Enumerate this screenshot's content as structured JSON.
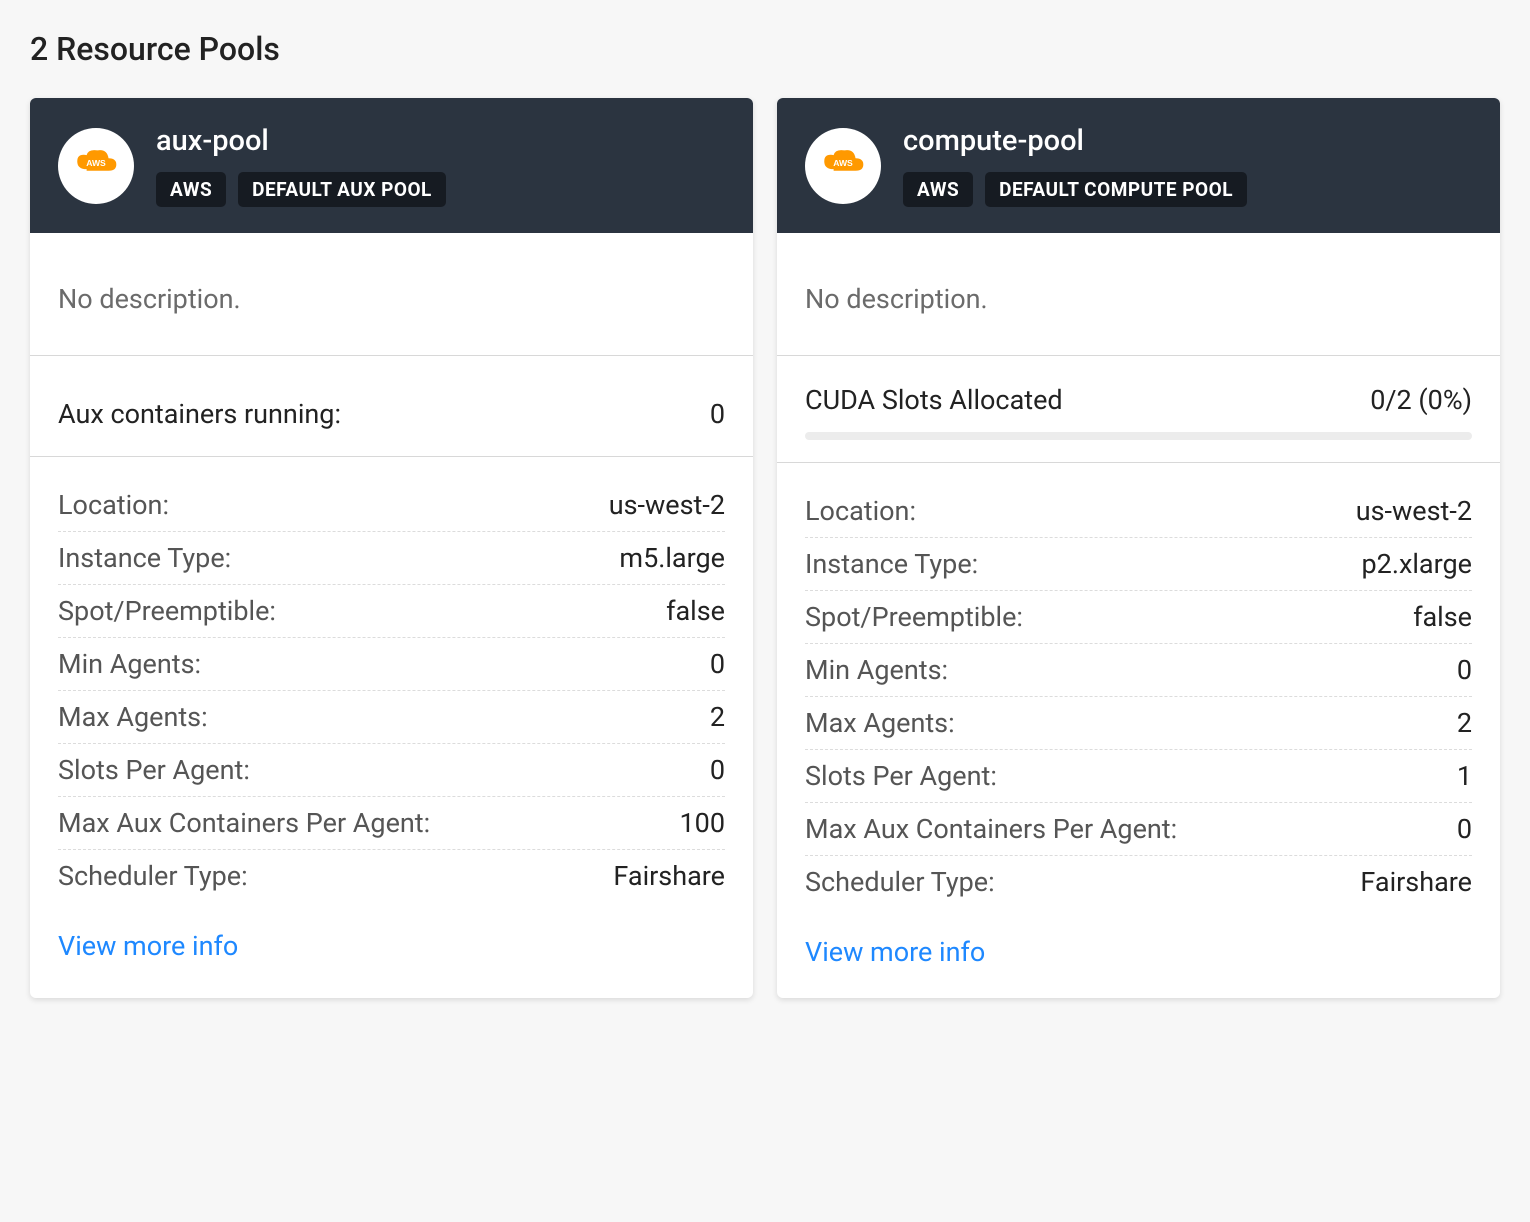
{
  "title": "2 Resource Pools",
  "viewMoreLabel": "View more info",
  "detailLabels": {
    "location": "Location:",
    "instanceType": "Instance Type:",
    "spot": "Spot/Preemptible:",
    "minAgents": "Min Agents:",
    "maxAgents": "Max Agents:",
    "slotsPerAgent": "Slots Per Agent:",
    "maxAuxPerAgent": "Max Aux Containers Per Agent:",
    "schedulerType": "Scheduler Type:"
  },
  "pools": [
    {
      "name": "aux-pool",
      "badges": [
        "AWS",
        "DEFAULT AUX POOL"
      ],
      "description": "No description.",
      "slots": null,
      "auxRunning": {
        "label": "Aux containers running:",
        "value": "0"
      },
      "details": {
        "location": "us-west-2",
        "instanceType": "m5.large",
        "spot": "false",
        "minAgents": "0",
        "maxAgents": "2",
        "slotsPerAgent": "0",
        "maxAuxPerAgent": "100",
        "schedulerType": "Fairshare"
      }
    },
    {
      "name": "compute-pool",
      "badges": [
        "AWS",
        "DEFAULT COMPUTE POOL"
      ],
      "description": "No description.",
      "slots": {
        "label": "CUDA Slots Allocated",
        "value": "0/2 (0%)"
      },
      "auxRunning": null,
      "details": {
        "location": "us-west-2",
        "instanceType": "p2.xlarge",
        "spot": "false",
        "minAgents": "0",
        "maxAgents": "2",
        "slotsPerAgent": "1",
        "maxAuxPerAgent": "0",
        "schedulerType": "Fairshare"
      }
    }
  ]
}
